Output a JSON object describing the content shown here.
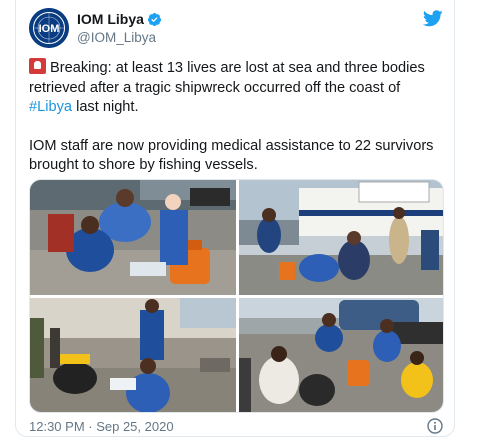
{
  "tweet": {
    "display_name": "IOM Libya",
    "handle": "@IOM_Libya",
    "verified": true,
    "avatar_text": "IOM",
    "text_part1": "Breaking: at least 13 lives are lost at sea and three bodies retrieved after a tragic shipwreck occurred off the coast of ",
    "hashtag": "#Libya",
    "text_part2": " last night.",
    "paragraph2": "IOM staff are now providing medical assistance to 22 survivors brought to shore by fishing vessels.",
    "timestamp": "12:30 PM · Sep 25, 2020"
  },
  "icons": {
    "siren": "rotating-light-icon",
    "bird": "twitter-bird-icon",
    "verified": "verified-badge-icon",
    "info": "info-icon"
  },
  "colors": {
    "accent": "#1b95e0",
    "text": "#14171a",
    "muted": "#657786",
    "border": "#e1e8ed",
    "iom_blue": "#0a3c82"
  },
  "media": {
    "photos": [
      {
        "alt": "Staff in blue vests assisting survivors on the ground at port"
      },
      {
        "alt": "Survivors sitting beside a white ship at the harbour"
      },
      {
        "alt": "Medical staff treating survivors under a shelter"
      },
      {
        "alt": "Survivors seated on the dock near a blue tanker"
      }
    ]
  }
}
